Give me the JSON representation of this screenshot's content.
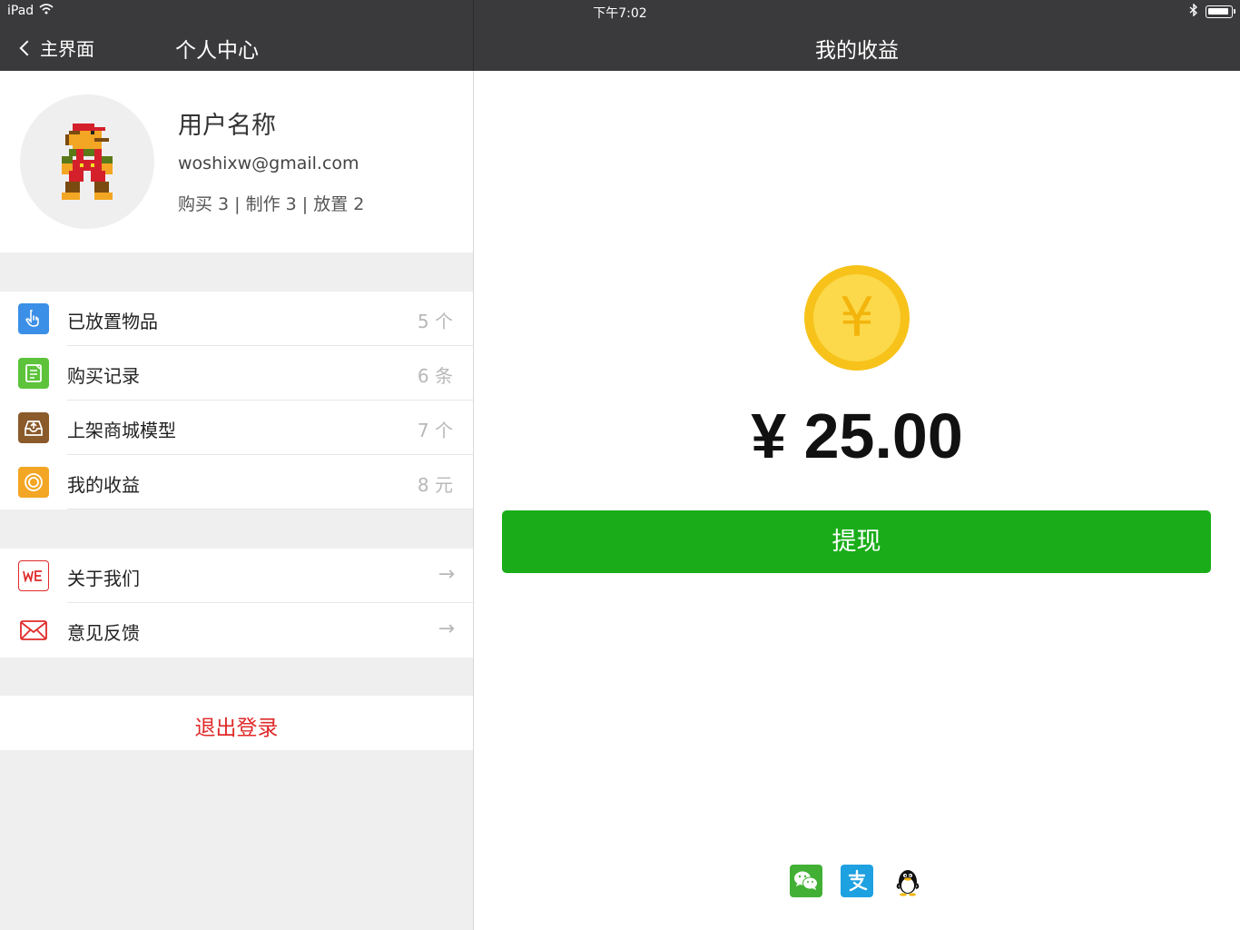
{
  "status_bar": {
    "device": "iPad",
    "time": "下午7:02"
  },
  "nav": {
    "back_label": "主界面",
    "left_title": "个人中心",
    "right_title": "我的收益"
  },
  "profile": {
    "name": "用户名称",
    "email": "woshixw@gmail.com",
    "stats": "购买 3 | 制作 3 | 放置 2"
  },
  "menu_main": [
    {
      "label": "已放置物品",
      "value": "5 个",
      "icon": "hand-pointer-icon",
      "color": "#3b8fe6"
    },
    {
      "label": "购买记录",
      "value": "6 条",
      "icon": "document-icon",
      "color": "#5cc33b"
    },
    {
      "label": "上架商城模型",
      "value": "7 个",
      "icon": "upload-tray-icon",
      "color": "#8b5a2b"
    },
    {
      "label": "我的收益",
      "value": "8 元",
      "icon": "coin-icon",
      "color": "#f3a623"
    }
  ],
  "menu_about": [
    {
      "label": "关于我们",
      "value": "→",
      "icon": "we-logo-icon",
      "color": "#e02a2a"
    },
    {
      "label": "意见反馈",
      "value": "→",
      "icon": "envelope-icon",
      "color": "#e02a2a"
    }
  ],
  "logout_label": "退出登录",
  "earnings": {
    "coin_symbol": "¥",
    "amount": "¥ 25.00",
    "withdraw_label": "提现"
  },
  "payment_icons": [
    "wechat-icon",
    "alipay-icon",
    "qq-icon"
  ]
}
